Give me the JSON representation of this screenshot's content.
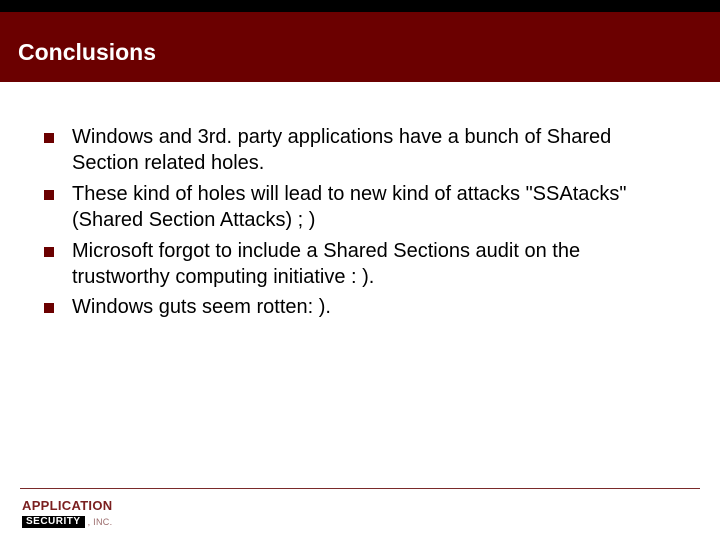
{
  "header": {
    "title": "Conclusions"
  },
  "bullets": {
    "items": [
      {
        "text": "Windows and 3rd. party applications have a bunch of Shared Section related holes."
      },
      {
        "text": "These kind of holes will lead to new kind of attacks \"SSAtacks\" (Shared Section Attacks) ; )"
      },
      {
        "text": "Microsoft forgot to include a Shared Sections audit on the trustworthy computing initiative : )."
      },
      {
        "text": "Windows guts seem rotten: )."
      }
    ]
  },
  "footer": {
    "logo_top": "APPLICATION",
    "logo_security": "SECURITY",
    "logo_inc": ", INC."
  }
}
